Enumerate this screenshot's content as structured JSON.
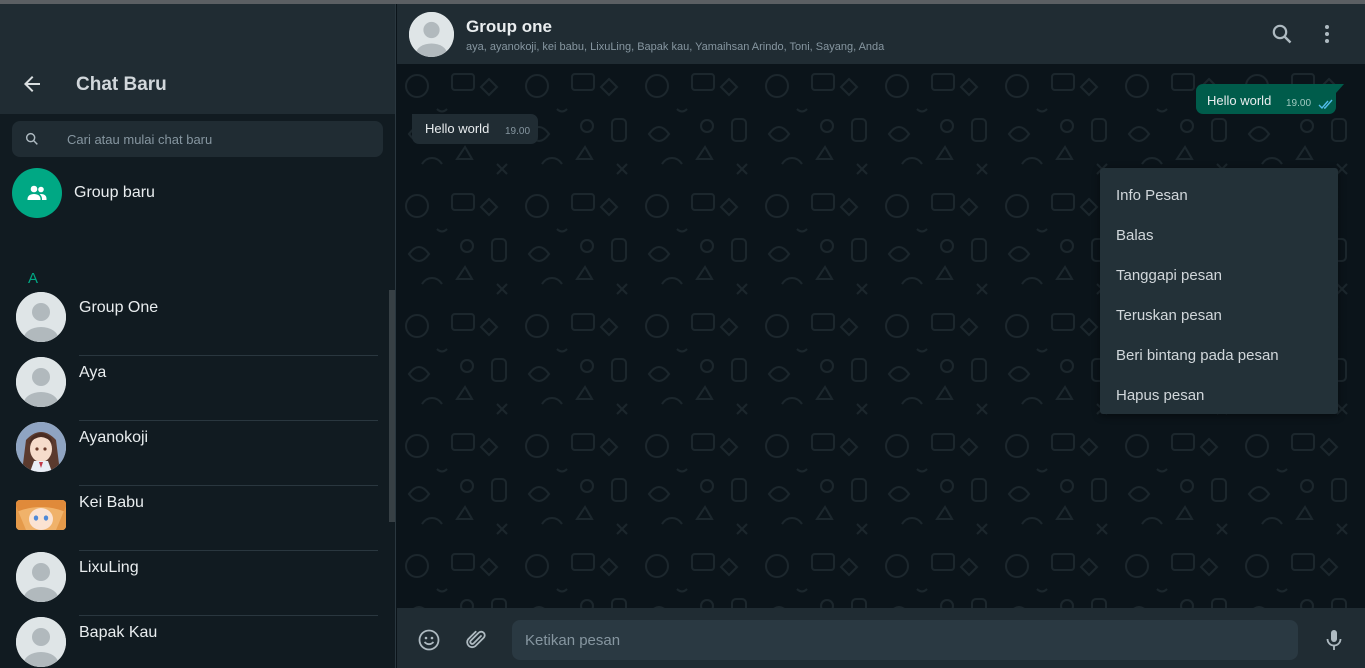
{
  "sidebar": {
    "title": "Chat Baru",
    "search_placeholder": "Cari atau mulai chat baru",
    "new_group_label": "Group baru",
    "section_letter": "A",
    "contacts": [
      {
        "name": "Group One",
        "avatar": "default"
      },
      {
        "name": "Aya",
        "avatar": "default"
      },
      {
        "name": "Ayanokoji",
        "avatar": "anime-photo"
      },
      {
        "name": "Kei Babu",
        "avatar": "anime-photo"
      },
      {
        "name": "LixuLing",
        "avatar": "default"
      },
      {
        "name": "Bapak Kau",
        "avatar": "default"
      }
    ]
  },
  "chat": {
    "title": "Group one",
    "members": "aya, ayanokoji, kei babu, LixuLing, Bapak kau, Yamaihsan Arindo, Toni, Sayang, Anda",
    "messages": [
      {
        "direction": "in",
        "text": "Hello world",
        "time": "19.00"
      },
      {
        "direction": "out",
        "text": "Hello world",
        "time": "19.00",
        "status": "read"
      }
    ],
    "input_placeholder": "Ketikan pesan"
  },
  "context_menu": {
    "items": [
      "Info Pesan",
      "Balas",
      "Tanggapi pesan",
      "Teruskan pesan",
      "Beri bintang pada pesan",
      "Hapus pesan"
    ]
  },
  "colors": {
    "accent": "#00a884",
    "panel": "#202c33",
    "background": "#111b21",
    "outgoing_bubble": "#005c4b",
    "read_ticks": "#53bdeb"
  },
  "icons": [
    "back-arrow-icon",
    "search-icon",
    "group-icon",
    "menu-dots-icon",
    "emoji-icon",
    "attach-icon",
    "mic-icon",
    "double-check-icon"
  ]
}
